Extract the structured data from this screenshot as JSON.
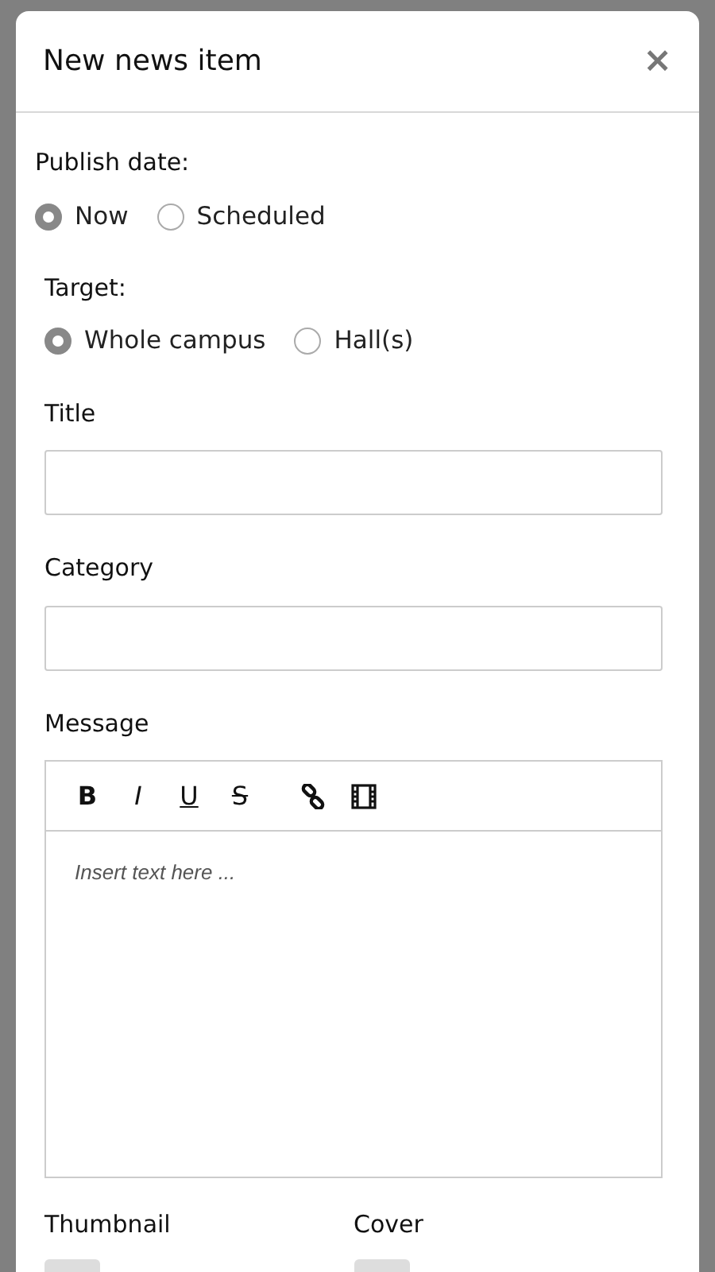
{
  "dialog": {
    "title": "New news item",
    "close": "×"
  },
  "publish_date": {
    "label": "Publish date:",
    "options": [
      {
        "label": "Now",
        "selected": true
      },
      {
        "label": "Scheduled",
        "selected": false
      }
    ]
  },
  "target": {
    "label": "Target:",
    "options": [
      {
        "label": "Whole campus",
        "selected": true
      },
      {
        "label": "Hall(s)",
        "selected": false
      }
    ]
  },
  "fields": [
    {
      "label": "Title"
    },
    {
      "label": "Category"
    }
  ],
  "message": {
    "label": "Message",
    "toolbar": [
      {
        "kind": "bold",
        "label": "B"
      },
      {
        "kind": "italic",
        "label": "I"
      },
      {
        "kind": "underline",
        "label": "U"
      },
      {
        "kind": "strike",
        "label": "S"
      },
      {
        "kind": "link"
      },
      {
        "kind": "video"
      }
    ],
    "placeholder": "Insert text here ..."
  },
  "uploads": [
    {
      "label": "Thumbnail"
    },
    {
      "label": "Cover"
    }
  ]
}
